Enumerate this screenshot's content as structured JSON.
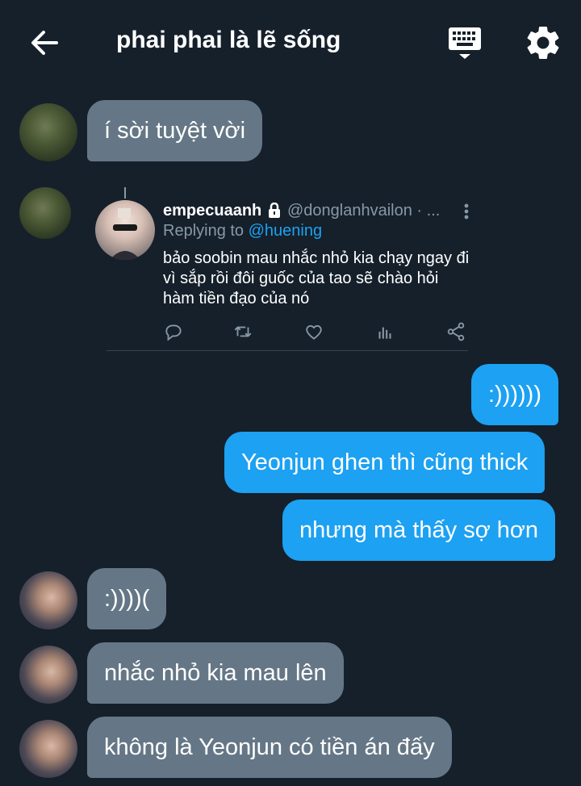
{
  "header": {
    "title": "phai phai là lẽ sống",
    "back_icon": "arrow-left-icon",
    "keyboard_icon": "keyboard-icon",
    "settings_icon": "gear-icon"
  },
  "colors": {
    "background": "#15202b",
    "incoming_bubble": "#657786",
    "outgoing_bubble": "#1da1f2",
    "muted_text": "#8899a6",
    "link": "#1da1f2"
  },
  "messages": [
    {
      "direction": "in",
      "text": "í sời tuyệt vời"
    },
    {
      "direction": "out",
      "text": ":))))))"
    },
    {
      "direction": "out",
      "text": "Yeonjun ghen thì cũng thick"
    },
    {
      "direction": "out",
      "text": "nhưng mà thấy sợ hơn"
    },
    {
      "direction": "in",
      "text": ":))))("
    },
    {
      "direction": "in",
      "text": "nhắc nhỏ kia mau lên"
    },
    {
      "direction": "in",
      "text": "không là Yeonjun có tiền án đấy"
    }
  ],
  "shared_tweet": {
    "name": "empecuaanh",
    "handle": "@donglanhvailon · ...",
    "replying_prefix": "Replying to",
    "replying_to": "@huening",
    "text": "bảo soobin mau nhắc nhỏ kia chạy ngay đi vì sắp rồi đôi guốc của tao sẽ chào hỏi hàm tiền đạo của nó",
    "actions": [
      "reply-icon",
      "retweet-icon",
      "like-icon",
      "analytics-icon",
      "share-icon"
    ]
  }
}
